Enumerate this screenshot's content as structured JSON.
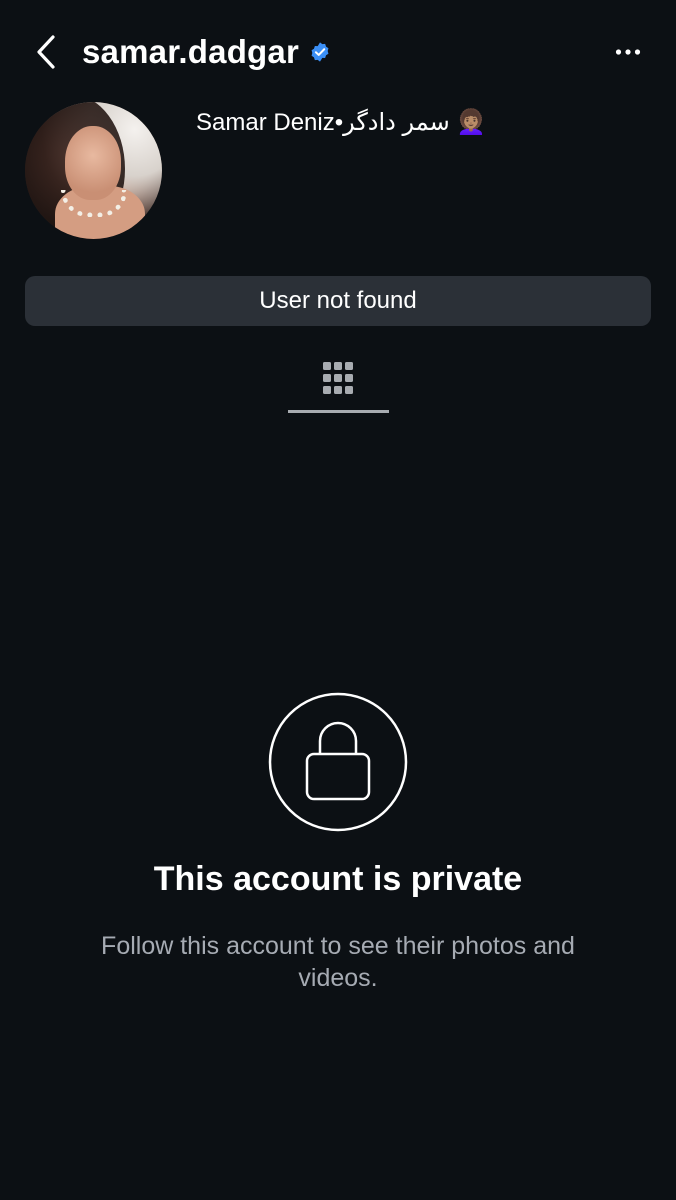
{
  "header": {
    "back_icon": "chevron-left-icon",
    "username": "samar.dadgar",
    "verified_icon": "verified-badge-icon",
    "verified_color": "#3b8ff6",
    "more_icon": "more-horizontal-icon"
  },
  "profile": {
    "avatar": "avatar",
    "display_name": "Samar Deniz•سمر دادگر 👩🏽‍🦱"
  },
  "status_bar": {
    "label": "User not found"
  },
  "tabs": {
    "grid_icon": "grid-icon"
  },
  "private": {
    "lock_icon": "lock-icon",
    "title": "This account is private",
    "subtitle": "Follow this account to see their photos and videos."
  },
  "colors": {
    "background": "#0c1014",
    "status_bar_bg": "#2b3037",
    "muted_text": "#a6abb3",
    "accent_blue": "#3b8ff6"
  }
}
